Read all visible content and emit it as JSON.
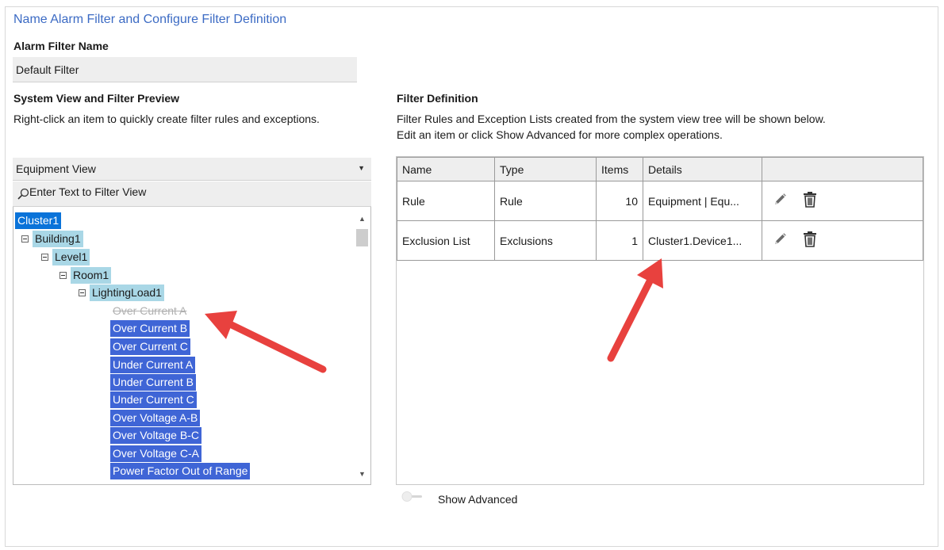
{
  "page": {
    "title": "Name Alarm Filter and Configure Filter Definition",
    "filter_name_label": "Alarm Filter Name",
    "filter_name_value": "Default Filter"
  },
  "system_view": {
    "heading": "System View and Filter Preview",
    "description": "Right-click an item to quickly create filter rules and exceptions.",
    "view_select": "Equipment View",
    "filter_placeholder": "Enter Text to Filter View",
    "tree": [
      "Cluster1",
      "Building1",
      "Level1",
      "Room1",
      "LightingLoad1",
      "Over Current A",
      "Over Current B",
      "Over Current C",
      "Under Current A",
      "Under Current B",
      "Under Current C",
      "Over Voltage A-B",
      "Over Voltage B-C",
      "Over Voltage C-A",
      "Power Factor Out of Range"
    ]
  },
  "filter_definition": {
    "heading": "Filter Definition",
    "description_line1": "Filter Rules and Exception Lists created from the system view tree will be shown below.",
    "description_line2": "Edit an item or click Show Advanced for more complex operations.",
    "columns": [
      "Name",
      "Type",
      "Items",
      "Details"
    ],
    "rows": [
      {
        "name": "Rule",
        "type": "Rule",
        "items": "10",
        "details": "Equipment | Equ..."
      },
      {
        "name": "Exclusion List",
        "type": "Exclusions",
        "items": "1",
        "details": "Cluster1.Device1..."
      }
    ]
  },
  "advanced": {
    "label": "Show Advanced",
    "enabled": false
  },
  "colors": {
    "title_blue": "#3c6bc4",
    "selection_dark": "#0a73d9",
    "selection_light": "#a9d7e6",
    "selection_blue": "#3f65d6",
    "annotation_arrow": "#e8413e"
  },
  "icons": [
    "search-icon",
    "chevron-down-icon",
    "minus-box-icon",
    "pencil-icon",
    "trash-icon"
  ]
}
